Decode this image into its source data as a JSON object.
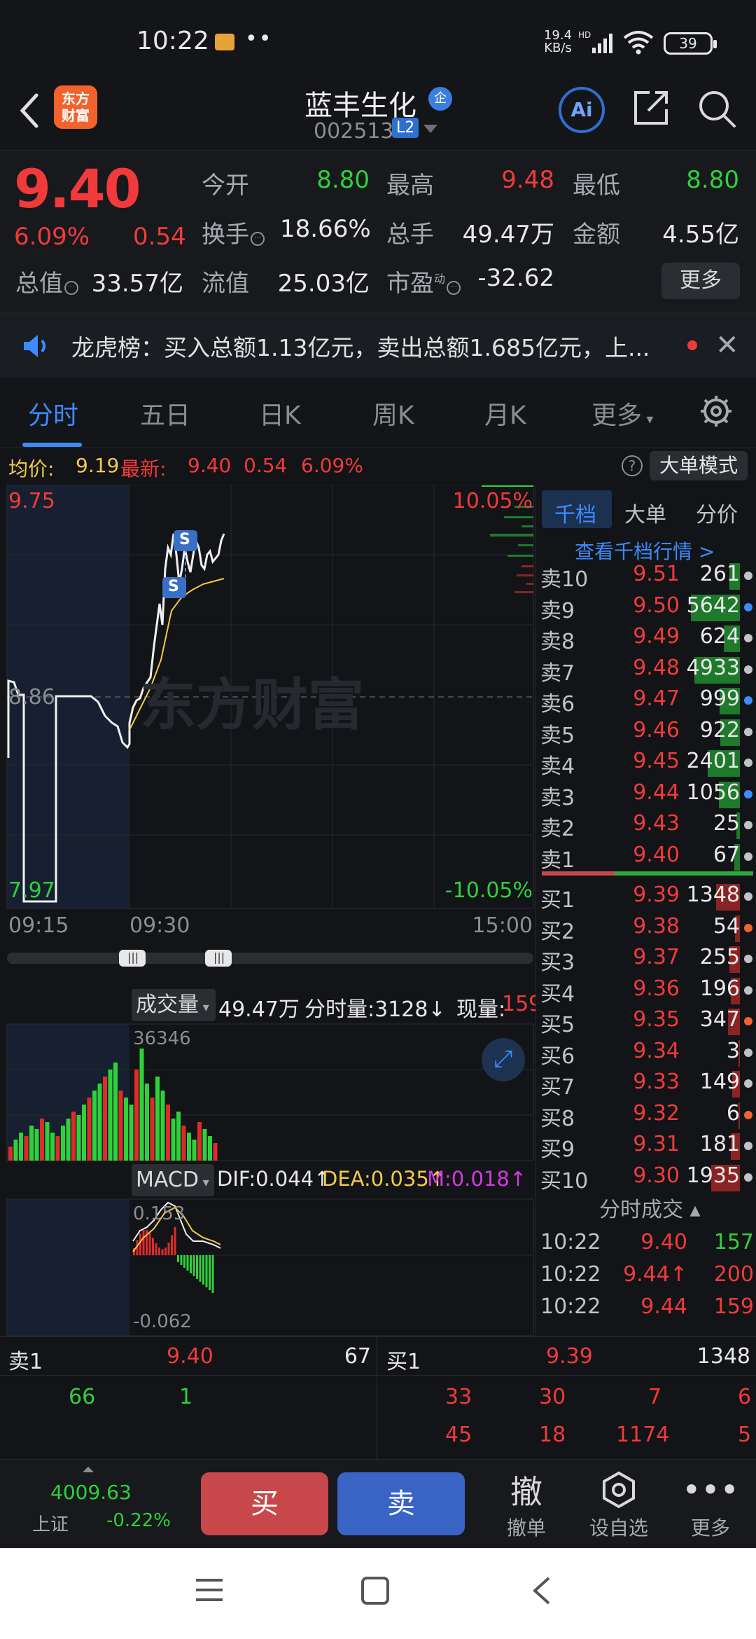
{
  "status_bar": {
    "time": "10:22",
    "speed_top": "19.4",
    "speed_bottom": "KB/s",
    "battery": "39"
  },
  "header": {
    "logo_line1": "东方",
    "logo_line2": "财富",
    "stock_name": "蓝丰生化",
    "qi_badge": "企",
    "stock_code": "002513",
    "level_badge": "L2",
    "ai_label": "Ai"
  },
  "quote": {
    "price": "9.40",
    "change_pct": "6.09%",
    "change": "0.54",
    "open_label": "今开",
    "open": "8.80",
    "high_label": "最高",
    "high": "9.48",
    "low_label": "最低",
    "low": "8.80",
    "turnover_label": "换手",
    "turnover": "18.66%",
    "volume_label": "总手",
    "volume": "49.47万",
    "amount_label": "金额",
    "amount": "4.55亿",
    "mktcap_label": "总值",
    "mktcap": "33.57亿",
    "float_label": "流值",
    "float_cap": "25.03亿",
    "pe_label": "市盈",
    "pe_super": "动",
    "pe": "-32.62",
    "more_label": "更多"
  },
  "notice": {
    "text": "龙虎榜：买入总额1.13亿元，卖出总额1.685亿元，上..."
  },
  "tabs": [
    {
      "label": "分时"
    },
    {
      "label": "五日"
    },
    {
      "label": "日K"
    },
    {
      "label": "周K"
    },
    {
      "label": "月K"
    },
    {
      "label": "更多"
    }
  ],
  "avg_bar": {
    "avg_label": "均价:",
    "avg_value": "9.19",
    "latest_label": "最新:",
    "latest_value": "9.40",
    "latest_change": "0.54",
    "latest_pct": "6.09%",
    "big_order_mode": "大单模式"
  },
  "chart": {
    "y_max": "9.75",
    "y_mid": "8.86",
    "y_min": "7.97",
    "pct_max": "10.05%",
    "pct_min": "-10.05%",
    "time_start": "09:15",
    "time_mid": "09:30",
    "time_end": "15:00",
    "watermark": "东方财富",
    "marker_s": "S",
    "volume_label": "成交量",
    "volume_total": "49.47万",
    "minute_volume": "分时量:3128↓",
    "current_volume_label": "现量:",
    "current_volume_value": "159",
    "volume_axis": "36346",
    "macd_label": "MACD",
    "dif": "DIF:0.044↑",
    "dea": "DEA:0.035↑",
    "m": "M:0.018↑",
    "macd_max": "0.153",
    "macd_min": "-0.062"
  },
  "order_book": {
    "tabs": [
      {
        "label": "千档"
      },
      {
        "label": "大单"
      },
      {
        "label": "分价"
      }
    ],
    "link": "查看千档行情 >",
    "asks": [
      {
        "side": "卖10",
        "price": "9.51",
        "vol": "261"
      },
      {
        "side": "卖9",
        "price": "9.50",
        "vol": "5642"
      },
      {
        "side": "卖8",
        "price": "9.49",
        "vol": "624"
      },
      {
        "side": "卖7",
        "price": "9.48",
        "vol": "4933"
      },
      {
        "side": "卖6",
        "price": "9.47",
        "vol": "999"
      },
      {
        "side": "卖5",
        "price": "9.46",
        "vol": "922"
      },
      {
        "side": "卖4",
        "price": "9.45",
        "vol": "2401"
      },
      {
        "side": "卖3",
        "price": "9.44",
        "vol": "1056"
      },
      {
        "side": "卖2",
        "price": "9.43",
        "vol": "25"
      },
      {
        "side": "卖1",
        "price": "9.40",
        "vol": "67"
      }
    ],
    "bids": [
      {
        "side": "买1",
        "price": "9.39",
        "vol": "1348"
      },
      {
        "side": "买2",
        "price": "9.38",
        "vol": "54"
      },
      {
        "side": "买3",
        "price": "9.37",
        "vol": "255"
      },
      {
        "side": "买4",
        "price": "9.36",
        "vol": "196"
      },
      {
        "side": "买5",
        "price": "9.35",
        "vol": "347"
      },
      {
        "side": "买6",
        "price": "9.34",
        "vol": "3"
      },
      {
        "side": "买7",
        "price": "9.33",
        "vol": "149"
      },
      {
        "side": "买8",
        "price": "9.32",
        "vol": "6"
      },
      {
        "side": "买9",
        "price": "9.31",
        "vol": "181"
      },
      {
        "side": "买10",
        "price": "9.30",
        "vol": "1935"
      }
    ],
    "trades_title": "分时成交",
    "trades": [
      {
        "time": "10:22",
        "price": "9.40",
        "vol": "157"
      },
      {
        "time": "10:22",
        "price": "9.44↑",
        "vol": "200"
      },
      {
        "time": "10:22",
        "price": "9.44",
        "vol": "159"
      }
    ]
  },
  "bottom_quote": {
    "left_side": "卖1",
    "left_price": "9.40",
    "left_vol": "67",
    "right_side": "买1",
    "right_price": "9.39",
    "right_vol": "1348",
    "left_row2": [
      "66",
      "1"
    ],
    "right_row2": [
      "33",
      "30",
      "7",
      "6"
    ],
    "right_row3": [
      "45",
      "18",
      "1174",
      "5"
    ]
  },
  "actions": {
    "index_value": "4009.63",
    "index_name": "上证",
    "index_pct": "-0.22%",
    "buy": "买",
    "sell": "卖",
    "cancel_glyph": "撤",
    "cancel": "撤单",
    "watchlist": "设自选",
    "more": "更多"
  },
  "colors": {
    "up": "#f23a3a",
    "down": "#2fd13a",
    "accent": "#3d8bff",
    "avg_line": "#f2c94c"
  }
}
